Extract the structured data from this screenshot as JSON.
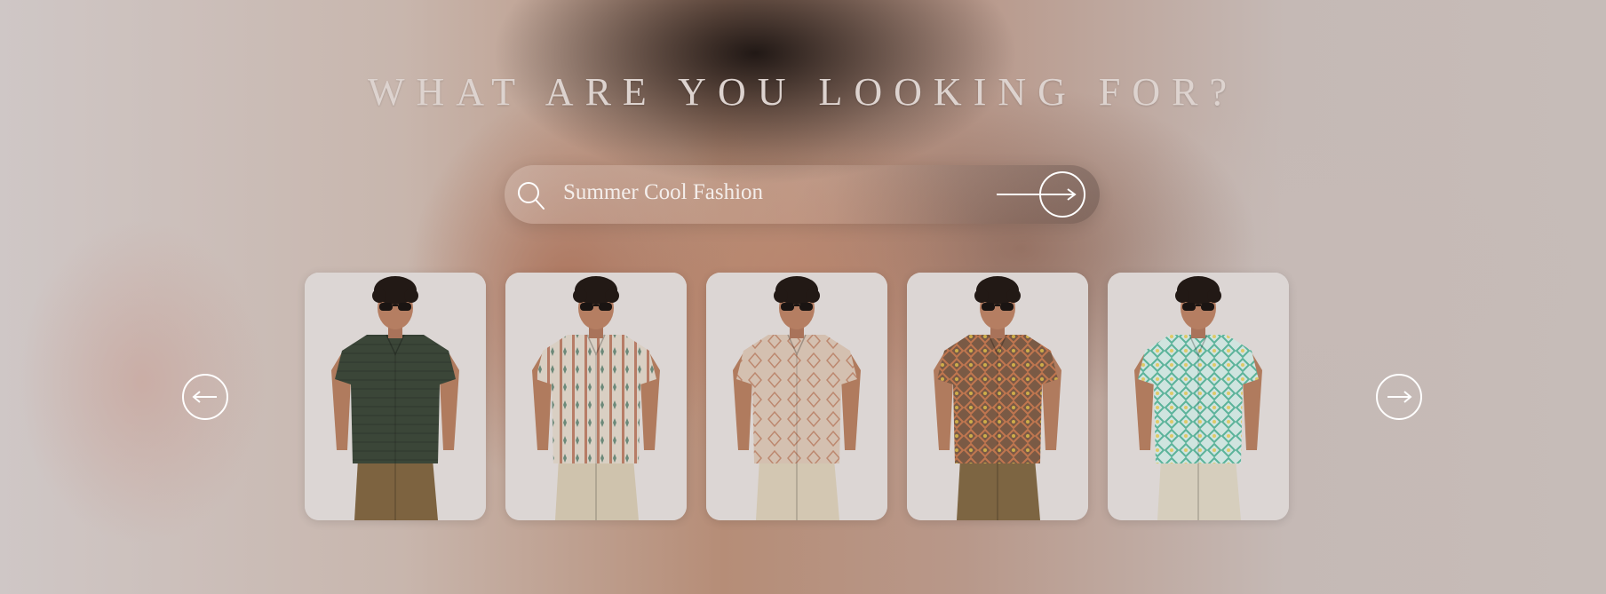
{
  "heading": "WHAT ARE YOU LOOKING FOR?",
  "search": {
    "value": "Summer Cool Fashion",
    "icon": "search-icon",
    "submit_icon": "arrow-right-icon"
  },
  "carousel": {
    "prev_icon": "arrow-left-icon",
    "next_icon": "arrow-right-icon",
    "products": [
      {
        "name": "product-card-1",
        "shirt_color": "#3b4638",
        "pattern": "solid",
        "accent": "#2c352a",
        "trousers": "#7d6340"
      },
      {
        "name": "product-card-2",
        "shirt_color": "#d9cfc3",
        "pattern": "stripe",
        "accent": "#a8583f",
        "trousers": "#cfc3ad"
      },
      {
        "name": "product-card-3",
        "shirt_color": "#d4c0b0",
        "pattern": "motif",
        "accent": "#b77a5f",
        "trousers": "#d3c7b2"
      },
      {
        "name": "product-card-4",
        "shirt_color": "#7a5a45",
        "pattern": "diamond",
        "accent": "#c0764f",
        "trousers": "#7d6542"
      },
      {
        "name": "product-card-5",
        "shirt_color": "#cfe4df",
        "pattern": "diamond",
        "accent": "#5bb39a",
        "trousers": "#d6cebd"
      }
    ]
  },
  "colors": {
    "heading": "#ddd3cf",
    "icon_stroke": "#ffffff",
    "card_bg": "#d9d3d1"
  }
}
